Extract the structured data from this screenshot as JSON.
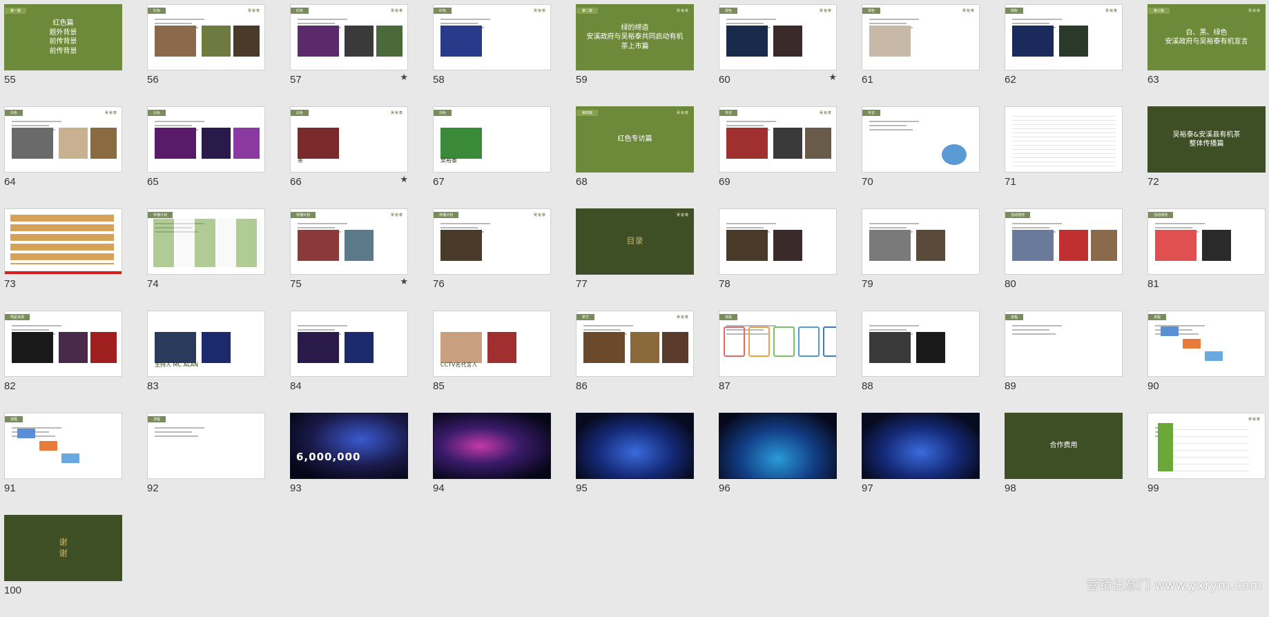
{
  "slides": [
    {
      "n": "55",
      "style": "green",
      "tag": "第一篇",
      "title": "红色篇\n题外背景\n前传背景\n前传背景",
      "logo": "",
      "star": false
    },
    {
      "n": "56",
      "style": "white",
      "tag": "红色",
      "title": "",
      "logo": "吴裕泰",
      "star": false,
      "photos": [
        "#8a6a4a",
        "#6d7a40",
        "#4a3a2a"
      ]
    },
    {
      "n": "57",
      "style": "white",
      "tag": "红色",
      "title": "",
      "logo": "吴裕泰",
      "star": true,
      "photos": [
        "#5a2a6a",
        "#3a3a3a",
        "#4a6a3a"
      ]
    },
    {
      "n": "58",
      "style": "white",
      "tag": "红色",
      "title": "",
      "logo": "吴裕泰",
      "star": false,
      "photos": [
        "#2a3a8a"
      ]
    },
    {
      "n": "59",
      "style": "green",
      "tag": "第二篇",
      "title": "绿的缔造\n安溪政府与吴裕泰共同启动有机茶上市篇",
      "logo": "吴裕泰",
      "star": false
    },
    {
      "n": "60",
      "style": "white",
      "tag": "绿色",
      "title": "",
      "logo": "吴裕泰",
      "star": true,
      "photos": [
        "#1a2a4a",
        "#3a2a2a"
      ]
    },
    {
      "n": "61",
      "style": "white",
      "tag": "绿色",
      "title": "",
      "logo": "吴裕泰",
      "star": false,
      "photos": [
        "#c8b8a8"
      ]
    },
    {
      "n": "62",
      "style": "white",
      "tag": "绿色",
      "title": "",
      "logo": "吴裕泰",
      "star": false,
      "photos": [
        "#1a2a5a",
        "#2a3a2a"
      ]
    },
    {
      "n": "63",
      "style": "green",
      "tag": "第三篇",
      "title": "白、黑、绿色\n安溪政府与吴裕泰有机宣言",
      "logo": "吴裕泰",
      "star": false
    },
    {
      "n": "64",
      "style": "white",
      "tag": "白色",
      "title": "",
      "logo": "吴裕泰",
      "star": false,
      "photos": [
        "#6a6a6a",
        "#c8b090",
        "#8a6a40"
      ]
    },
    {
      "n": "65",
      "style": "white",
      "tag": "白色",
      "title": "",
      "logo": "",
      "star": false,
      "photos": [
        "#5a1a6a",
        "#2a1a4a",
        "#8a3aa0"
      ]
    },
    {
      "n": "66",
      "style": "white",
      "tag": "白色",
      "title": "茶",
      "logo": "吴裕泰",
      "star": true,
      "photos": [
        "#7a2a2a"
      ]
    },
    {
      "n": "67",
      "style": "white",
      "tag": "白色",
      "title": "吴裕泰",
      "logo": "",
      "star": false,
      "photos": [
        "#3a8a3a"
      ]
    },
    {
      "n": "68",
      "style": "green",
      "tag": "第四篇",
      "title": "红色专访篇",
      "logo": "吴裕泰",
      "star": false
    },
    {
      "n": "69",
      "style": "white",
      "tag": "专访",
      "title": "",
      "logo": "吴裕泰",
      "star": false,
      "photos": [
        "#a03030",
        "#3a3a3a",
        "#6a5a4a"
      ]
    },
    {
      "n": "70",
      "style": "white",
      "tag": "专访",
      "title": "",
      "logo": "",
      "star": false,
      "pie": true
    },
    {
      "n": "71",
      "style": "white",
      "tag": "",
      "title": "",
      "logo": "",
      "star": false,
      "table": true
    },
    {
      "n": "72",
      "style": "dark",
      "tag": "",
      "title": "吴裕泰&安溪县有机茶\n整体传播篇",
      "logo": "",
      "star": false
    },
    {
      "n": "73",
      "style": "white",
      "tag": "",
      "title": "",
      "logo": "",
      "star": false,
      "chart": true
    },
    {
      "n": "74",
      "style": "white",
      "tag": "传播计划",
      "title": "",
      "logo": "",
      "star": false,
      "grid": true
    },
    {
      "n": "75",
      "style": "white",
      "tag": "传播计划",
      "title": "",
      "logo": "吴裕泰",
      "star": true,
      "photos": [
        "#8a3a3a",
        "#5a7a8a"
      ]
    },
    {
      "n": "76",
      "style": "white",
      "tag": "传播计划",
      "title": "",
      "logo": "吴裕泰",
      "star": false,
      "photos": [
        "#4a3a2a"
      ]
    },
    {
      "n": "77",
      "style": "dark",
      "tag": "",
      "title": "",
      "logo": "吴裕泰",
      "star": false,
      "seal": "目录"
    },
    {
      "n": "78",
      "style": "white",
      "tag": "",
      "title": "",
      "logo": "",
      "star": false,
      "photos": [
        "#4a3a2a",
        "#3a2a2a"
      ]
    },
    {
      "n": "79",
      "style": "white",
      "tag": "",
      "title": "",
      "logo": "",
      "star": false,
      "photos": [
        "#7a7a7a",
        "#5a4a3a"
      ]
    },
    {
      "n": "80",
      "style": "white",
      "tag": "活动场地",
      "title": "",
      "logo": "",
      "star": false,
      "photos": [
        "#6a7a9a",
        "#c03030",
        "#8a6a4a"
      ]
    },
    {
      "n": "81",
      "style": "white",
      "tag": "活动场地",
      "title": "",
      "logo": "",
      "star": false,
      "photos": [
        "#e05050",
        "#2a2a2a"
      ]
    },
    {
      "n": "82",
      "style": "white",
      "tag": "明星资源",
      "title": "",
      "logo": "",
      "star": false,
      "photos": [
        "#1a1a1a",
        "#4a2a4a",
        "#a02020"
      ]
    },
    {
      "n": "83",
      "style": "white",
      "tag": "",
      "title": "主持人 MC ALAN",
      "logo": "",
      "star": false,
      "photos": [
        "#2a3a5a",
        "#1a2a6a"
      ]
    },
    {
      "n": "84",
      "style": "white",
      "tag": "",
      "title": "",
      "logo": "",
      "star": false,
      "photos": [
        "#2a1a4a",
        "#1a2a6a"
      ]
    },
    {
      "n": "85",
      "style": "white",
      "tag": "",
      "title": "CCTV名代言人",
      "logo": "",
      "star": false,
      "photos": [
        "#c8a080",
        "#a03030"
      ]
    },
    {
      "n": "86",
      "style": "white",
      "tag": "茶艺",
      "title": "",
      "logo": "吴裕泰",
      "star": false,
      "photos": [
        "#6a4a2a",
        "#8a6a3a",
        "#5a3a2a"
      ]
    },
    {
      "n": "87",
      "style": "white",
      "tag": "流程",
      "title": "",
      "logo": "",
      "star": false,
      "boxes": true
    },
    {
      "n": "88",
      "style": "white",
      "tag": "",
      "title": "",
      "logo": "",
      "star": false,
      "photos": [
        "#3a3a3a",
        "#1a1a1a"
      ]
    },
    {
      "n": "89",
      "style": "white",
      "tag": "流程",
      "title": "",
      "logo": "",
      "star": false
    },
    {
      "n": "90",
      "style": "white",
      "tag": "流程",
      "title": "",
      "logo": "",
      "star": false,
      "flow": true
    },
    {
      "n": "91",
      "style": "white",
      "tag": "流程",
      "title": "",
      "logo": "",
      "star": false,
      "flow": true
    },
    {
      "n": "92",
      "style": "white",
      "tag": "流程",
      "title": "",
      "logo": "",
      "star": false
    },
    {
      "n": "93",
      "style": "black",
      "tag": "",
      "title": "",
      "logo": "",
      "star": false,
      "stage": "v4",
      "bigtext": "6,000,000"
    },
    {
      "n": "94",
      "style": "black",
      "tag": "",
      "title": "",
      "logo": "",
      "star": false,
      "stage": "v3"
    },
    {
      "n": "95",
      "style": "black",
      "tag": "",
      "title": "",
      "logo": "",
      "star": false,
      "stage": "v1"
    },
    {
      "n": "96",
      "style": "black",
      "tag": "",
      "title": "",
      "logo": "",
      "star": false,
      "stage": "v2"
    },
    {
      "n": "97",
      "style": "black",
      "tag": "",
      "title": "",
      "logo": "",
      "star": false,
      "stage": "v1"
    },
    {
      "n": "98",
      "style": "dark",
      "tag": "",
      "title": "合作费用",
      "logo": "",
      "star": false
    },
    {
      "n": "99",
      "style": "white",
      "tag": "",
      "title": "",
      "logo": "吴裕泰",
      "star": false,
      "table2": true
    },
    {
      "n": "100",
      "style": "dark",
      "tag": "",
      "title": "",
      "logo": "",
      "star": false,
      "seal": "谢\n谢"
    }
  ],
  "watermark": "营销任意门 www.yxrym.com",
  "colors": {
    "green": "#6d8a3a",
    "dark": "#3f4f25",
    "background": "#e8e8e8"
  }
}
